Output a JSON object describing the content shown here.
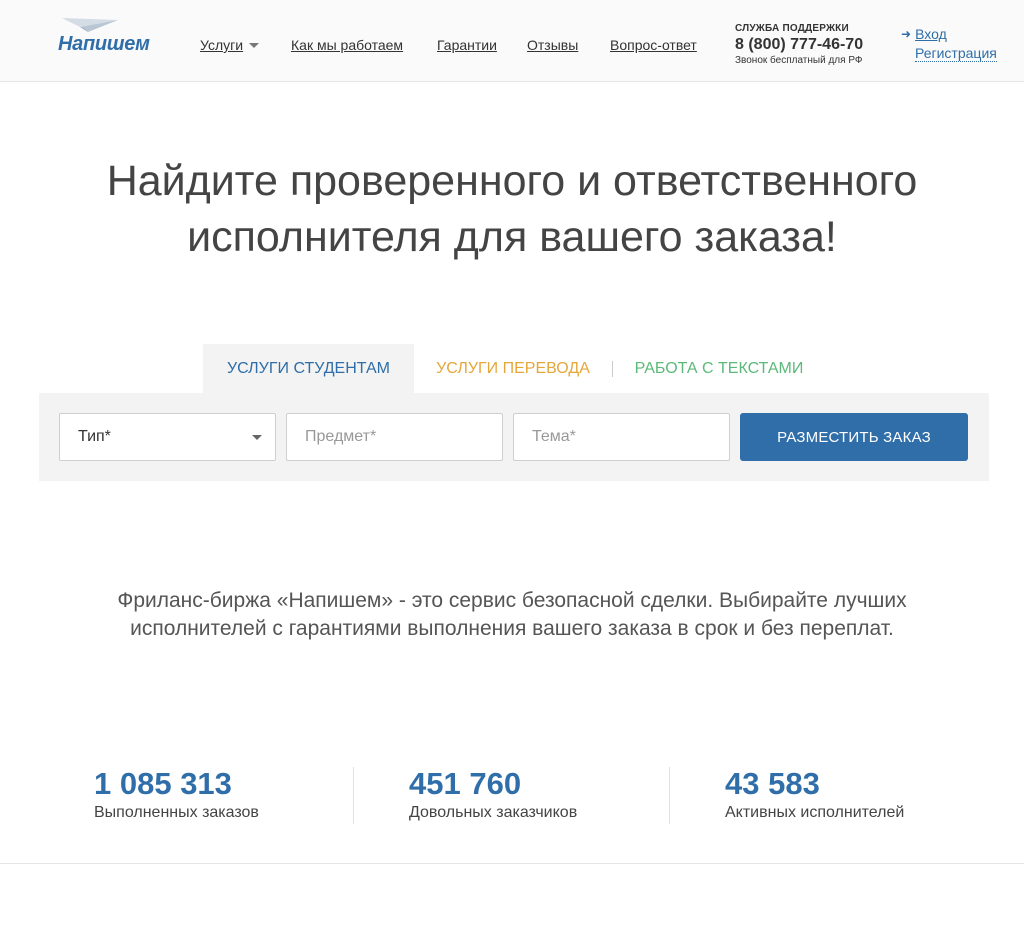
{
  "brand": {
    "logo_text": "Напишем"
  },
  "nav": {
    "services": "Услуги",
    "how": "Как мы работаем",
    "guarantees": "Гарантии",
    "reviews": "Отзывы",
    "faq": "Вопрос-ответ"
  },
  "support": {
    "title": "СЛУЖБА ПОДДЕРЖКИ",
    "phone": "8 (800) 777-46-70",
    "note": "Звонок бесплатный для РФ"
  },
  "auth": {
    "login": "Вход",
    "register": "Регистрация"
  },
  "hero": {
    "line1": "Найдите проверенного и ответственного",
    "line2": "исполнителя для вашего заказа!"
  },
  "tabs": [
    {
      "label": "УСЛУГИ СТУДЕНТАМ",
      "active": true,
      "color": "#2f6ea9"
    },
    {
      "label": "УСЛУГИ ПЕРЕВОДА",
      "active": false,
      "color": "#e6a73a"
    },
    {
      "label": "РАБОТА С ТЕКСТАМИ",
      "active": false,
      "color": "#5cb979"
    }
  ],
  "form": {
    "type_value": "Тип*",
    "subject_placeholder": "Предмет*",
    "topic_placeholder": "Тема*",
    "submit": "РАЗМЕСТИТЬ ЗАКАЗ"
  },
  "description": {
    "line1": "Фриланс-биржа «Напишем» - это сервис безопасной сделки. Выбирайте лучших",
    "line2": "исполнителей с гарантиями выполнения вашего заказа в срок и без переплат."
  },
  "stats": [
    {
      "value": "1 085 313",
      "label": "Выполненных заказов"
    },
    {
      "value": "451 760",
      "label": "Довольных заказчиков"
    },
    {
      "value": "43 583",
      "label": "Активных исполнителей"
    }
  ],
  "colors": {
    "accent": "#2f6ea9",
    "orange": "#e6a73a",
    "green": "#5cb979"
  }
}
